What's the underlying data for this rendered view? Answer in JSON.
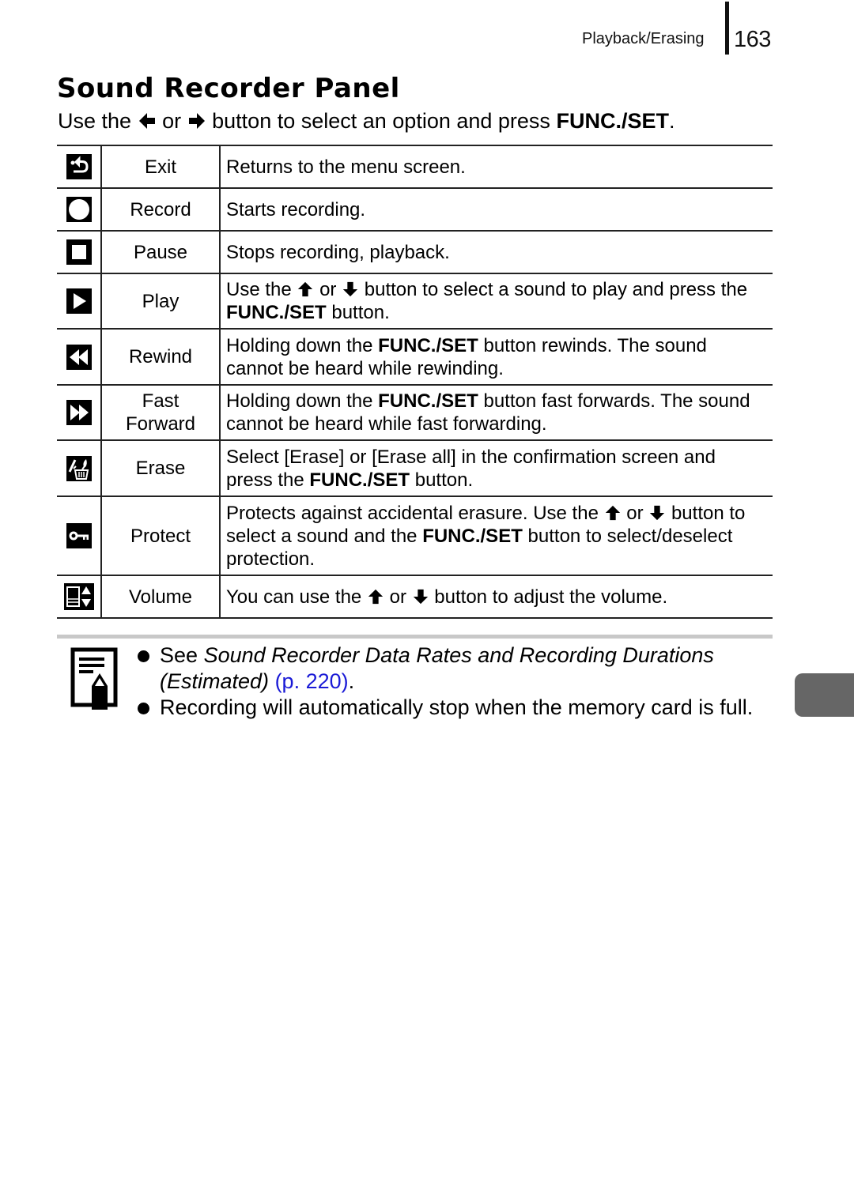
{
  "header": {
    "section": "Playback/Erasing",
    "page_number": "163"
  },
  "title": "Sound Recorder Panel",
  "intro": {
    "prefix": "Use the",
    "left_arrow_icon": "left-arrow-icon",
    "or": "or",
    "right_arrow_icon": "right-arrow-icon",
    "middle": "button to select an option and press",
    "bold": "FUNC./SET",
    "suffix": "."
  },
  "table": {
    "rows": [
      {
        "icon": "exit-icon",
        "name": "Exit",
        "desc": [
          "Returns to the menu screen."
        ]
      },
      {
        "icon": "record-icon",
        "name": "Record",
        "desc": [
          "Starts recording."
        ]
      },
      {
        "icon": "pause-icon",
        "name": "Pause",
        "desc": [
          "Stops recording, playback."
        ]
      },
      {
        "icon": "play-icon",
        "name": "Play",
        "desc": [
          "Use the",
          "or",
          "button to select a sound to play and press the",
          "FUNC./SET",
          "button."
        ]
      },
      {
        "icon": "rewind-icon",
        "name": "Rewind",
        "desc": [
          "Holding down the",
          "FUNC./SET",
          "button rewinds. The sound cannot be heard while rewinding."
        ]
      },
      {
        "icon": "fast-forward-icon",
        "name_lines": [
          "Fast",
          "Forward"
        ],
        "desc": [
          "Holding down the",
          "FUNC./SET",
          "button fast forwards. The sound cannot be heard while fast forwarding."
        ]
      },
      {
        "icon": "erase-icon",
        "name": "Erase",
        "desc": [
          "Select [Erase] or [Erase all] in the confirmation screen and press the",
          "FUNC./SET",
          "button."
        ]
      },
      {
        "icon": "protect-icon",
        "name": "Protect",
        "desc": [
          "Protects against accidental erasure. Use the",
          "or",
          "button to select a sound and the",
          "FUNC./SET",
          "button to select/deselect protection."
        ]
      },
      {
        "icon": "volume-icon",
        "name": "Volume",
        "desc": [
          "You can use the",
          "or",
          "button to adjust the volume."
        ]
      }
    ]
  },
  "notes": {
    "icon": "memo-pencil-icon",
    "items": [
      {
        "prefix": "See",
        "italic": "Sound Recorder Data Rates and Recording Durations (Estimated)",
        "link": "(p. 220)",
        "suffix": "."
      },
      {
        "text": "Recording will automatically stop when the memory card is full."
      }
    ]
  },
  "colors": {
    "link": "#1a1ad6",
    "side_tab": "#666666",
    "rule_gray": "#c8c8c8"
  }
}
